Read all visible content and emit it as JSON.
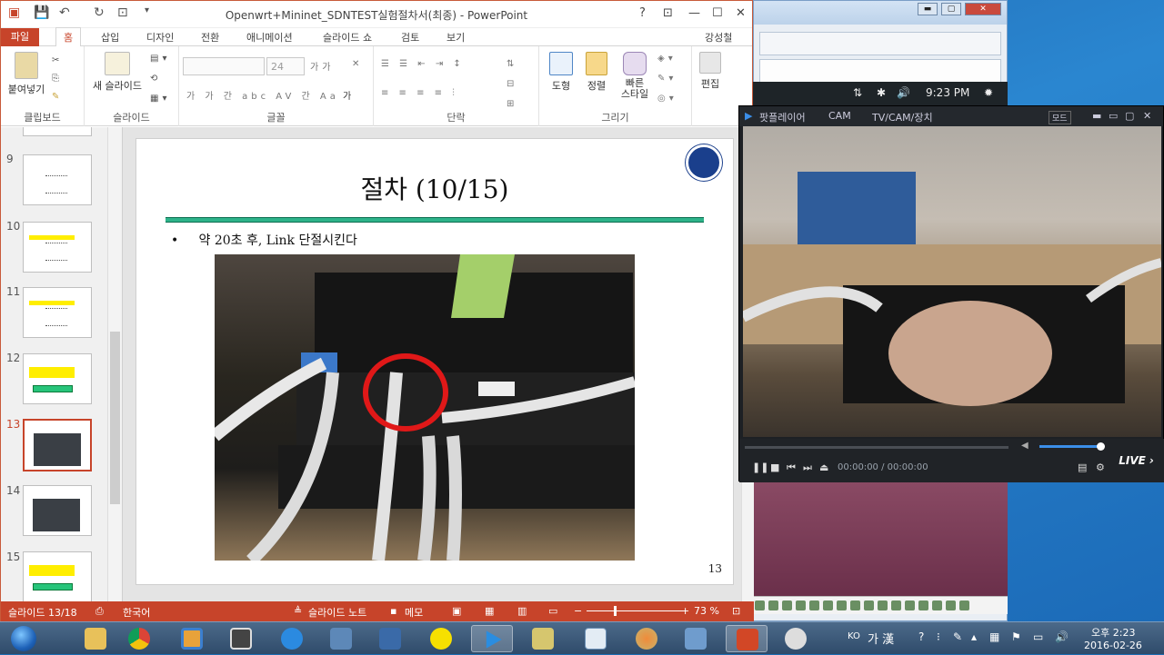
{
  "powerpoint": {
    "title": "Openwrt+Mininet_SDNTEST실험절차서(최종) - PowerPoint",
    "window_controls": [
      "?",
      "⊡",
      "—",
      "☐",
      "✕"
    ],
    "tabs": [
      "파일",
      "홈",
      "삽입",
      "디자인",
      "전환",
      "애니메이션",
      "슬라이드 쇼",
      "검토",
      "보기"
    ],
    "user": "강성철",
    "ribbon": {
      "clipboard": {
        "paste_label": "붙여넣기",
        "group_label": "클립보드"
      },
      "slides": {
        "new_slide_label": "새 슬라이드",
        "group_label": "슬라이드"
      },
      "font": {
        "size_value": "24",
        "group_label": "글꼴"
      },
      "paragraph": {
        "group_label": "단락"
      },
      "drawing": {
        "shapes_label": "도형",
        "arrange_label": "정렬",
        "quick_styles_label1": "빠른",
        "quick_styles_label2": "스타일",
        "group_label": "그리기"
      },
      "editing": {
        "label": "편집"
      }
    },
    "thumbnails": [
      {
        "num": "9"
      },
      {
        "num": "10"
      },
      {
        "num": "11"
      },
      {
        "num": "12"
      },
      {
        "num": "13"
      },
      {
        "num": "14"
      },
      {
        "num": "15"
      }
    ],
    "slide": {
      "title": "절차 (10/15)",
      "bullet": "약 20초 후, Link 단절시킨다",
      "page_number": "13"
    },
    "statusbar": {
      "slide_info": "슬라이드 13/18",
      "language": "한국어",
      "notes": "슬라이드 노트",
      "comments": "메모",
      "zoom": "73 %"
    }
  },
  "player": {
    "menu": [
      "팟플레이어",
      "CAM",
      "TV/CAM/장치"
    ],
    "mode_label": "모드",
    "time": "00:00:00 / 00:00:00",
    "live_label": "LIVE"
  },
  "background_tray": {
    "time": "9:23 PM"
  },
  "taskbar": {
    "ime_lang": "KO",
    "ime_mode": "가 漢",
    "clock_time": "오후 2:23",
    "clock_date": "2016-02-26"
  }
}
